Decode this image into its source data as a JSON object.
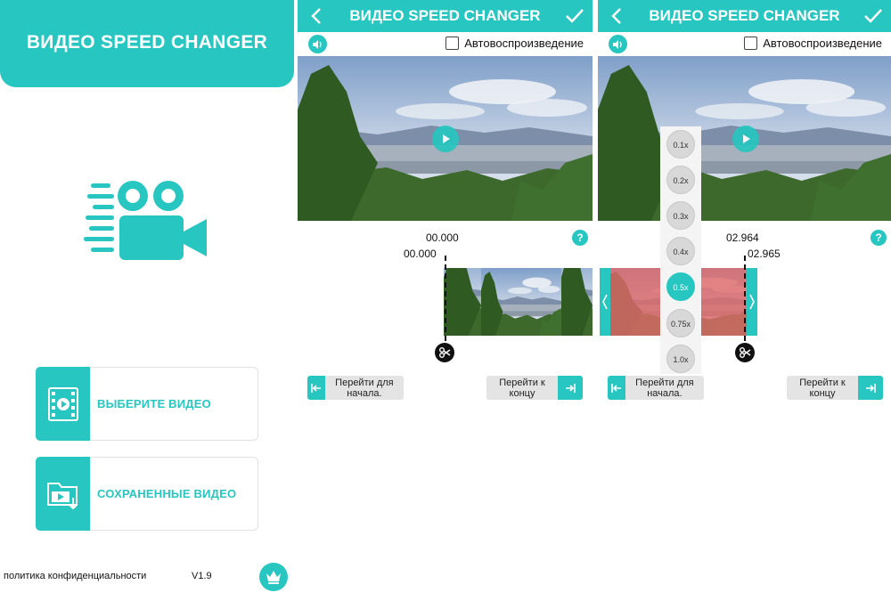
{
  "colors": {
    "accent": "#27c6c0",
    "selection": "#e06a6a"
  },
  "home": {
    "title": "ВИДЕО SPEED CHANGER",
    "logo_icon": "video-camera-icon",
    "select_video_label": "ВЫБЕРИТЕ ВИДЕО",
    "saved_videos_label": "СОХРАНЕННЫЕ ВИДЕО",
    "privacy_label": "политика конфиденциальности",
    "version": "V1.9",
    "premium_icon": "crown-icon"
  },
  "editor_a": {
    "title": "ВИДЕО SPEED CHANGER",
    "autoplay_label": "Автовоспроизведение",
    "help": "?",
    "time_top": "00.000",
    "time_cut": "00.000",
    "go_start_label": "Перейти для начала.",
    "go_end_label": "Перейти к концу"
  },
  "editor_b": {
    "title": "ВИДЕО SPEED CHANGER",
    "autoplay_label": "Автовоспроизведение",
    "help": "?",
    "time_top": "02.964",
    "time_cut": "02.965",
    "go_start_label": "Перейти для начала.",
    "go_end_label": "Перейти к концу",
    "speed_options": [
      "0.1x",
      "0.2x",
      "0.3x",
      "0.4x",
      "0.5x",
      "0.75x",
      "1.0x"
    ],
    "selected_speed": "0.5x"
  }
}
